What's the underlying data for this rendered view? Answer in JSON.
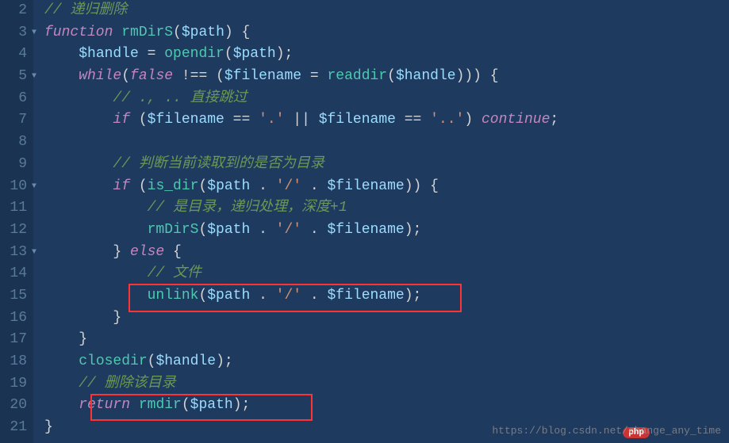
{
  "gutter": {
    "lines": [
      {
        "num": "2",
        "fold": false
      },
      {
        "num": "3",
        "fold": true
      },
      {
        "num": "4",
        "fold": false
      },
      {
        "num": "5",
        "fold": true
      },
      {
        "num": "6",
        "fold": false
      },
      {
        "num": "7",
        "fold": false
      },
      {
        "num": "8",
        "fold": false
      },
      {
        "num": "9",
        "fold": false
      },
      {
        "num": "10",
        "fold": true
      },
      {
        "num": "11",
        "fold": false
      },
      {
        "num": "12",
        "fold": false
      },
      {
        "num": "13",
        "fold": true
      },
      {
        "num": "14",
        "fold": false
      },
      {
        "num": "15",
        "fold": false
      },
      {
        "num": "16",
        "fold": false
      },
      {
        "num": "17",
        "fold": false
      },
      {
        "num": "18",
        "fold": false
      },
      {
        "num": "19",
        "fold": false
      },
      {
        "num": "20",
        "fold": false
      },
      {
        "num": "21",
        "fold": false
      }
    ]
  },
  "code": {
    "l2_comment": "// 递归删除",
    "l3_function": "function",
    "l3_name": "rmDirS",
    "l3_paren1": "(",
    "l3_var": "$path",
    "l3_paren2": ") {",
    "l4_var1": "$handle",
    "l4_eq": " = ",
    "l4_func": "opendir",
    "l4_paren1": "(",
    "l4_var2": "$path",
    "l4_paren2": ");",
    "l5_while": "while",
    "l5_paren1": "(",
    "l5_false": "false",
    "l5_neq": " !== (",
    "l5_var1": "$filename",
    "l5_eq": " = ",
    "l5_func": "readdir",
    "l5_paren2": "(",
    "l5_var2": "$handle",
    "l5_paren3": "))) {",
    "l6_comment": "// ., .. 直接跳过",
    "l7_if": "if",
    "l7_paren1": " (",
    "l7_var1": "$filename",
    "l7_eq1": " == ",
    "l7_str1": "'.'",
    "l7_or": " || ",
    "l7_var2": "$filename",
    "l7_eq2": " == ",
    "l7_str2": "'..'",
    "l7_paren2": ") ",
    "l7_continue": "continue",
    "l7_semi": ";",
    "l9_comment": "// 判断当前读取到的是否为目录",
    "l10_if": "if",
    "l10_paren1": " (",
    "l10_func": "is_dir",
    "l10_paren2": "(",
    "l10_var1": "$path",
    "l10_concat1": " . ",
    "l10_str": "'/'",
    "l10_concat2": " . ",
    "l10_var2": "$filename",
    "l10_paren3": ")) {",
    "l11_comment": "// 是目录，递归处理，深度+1",
    "l12_func": "rmDirS",
    "l12_paren1": "(",
    "l12_var1": "$path",
    "l12_concat1": " . ",
    "l12_str": "'/'",
    "l12_concat2": " . ",
    "l12_var2": "$filename",
    "l12_paren2": ");",
    "l13_close": "} ",
    "l13_else": "else",
    "l13_open": " {",
    "l14_comment": "// 文件",
    "l15_func": "unlink",
    "l15_paren1": "(",
    "l15_var1": "$path",
    "l15_concat1": " . ",
    "l15_str": "'/'",
    "l15_concat2": " . ",
    "l15_var2": "$filename",
    "l15_paren2": ");",
    "l16_close": "}",
    "l17_close": "}",
    "l18_func": "closedir",
    "l18_paren1": "(",
    "l18_var": "$handle",
    "l18_paren2": ");",
    "l19_comment": "// 删除该目录",
    "l20_return": "return",
    "l20_sp": " ",
    "l20_func": "rmdir",
    "l20_paren1": "(",
    "l20_var": "$path",
    "l20_paren2": ");",
    "l21_close": "}"
  },
  "watermark_text": "https://blog.csdn.net/change_any_time",
  "php_badge": "php"
}
